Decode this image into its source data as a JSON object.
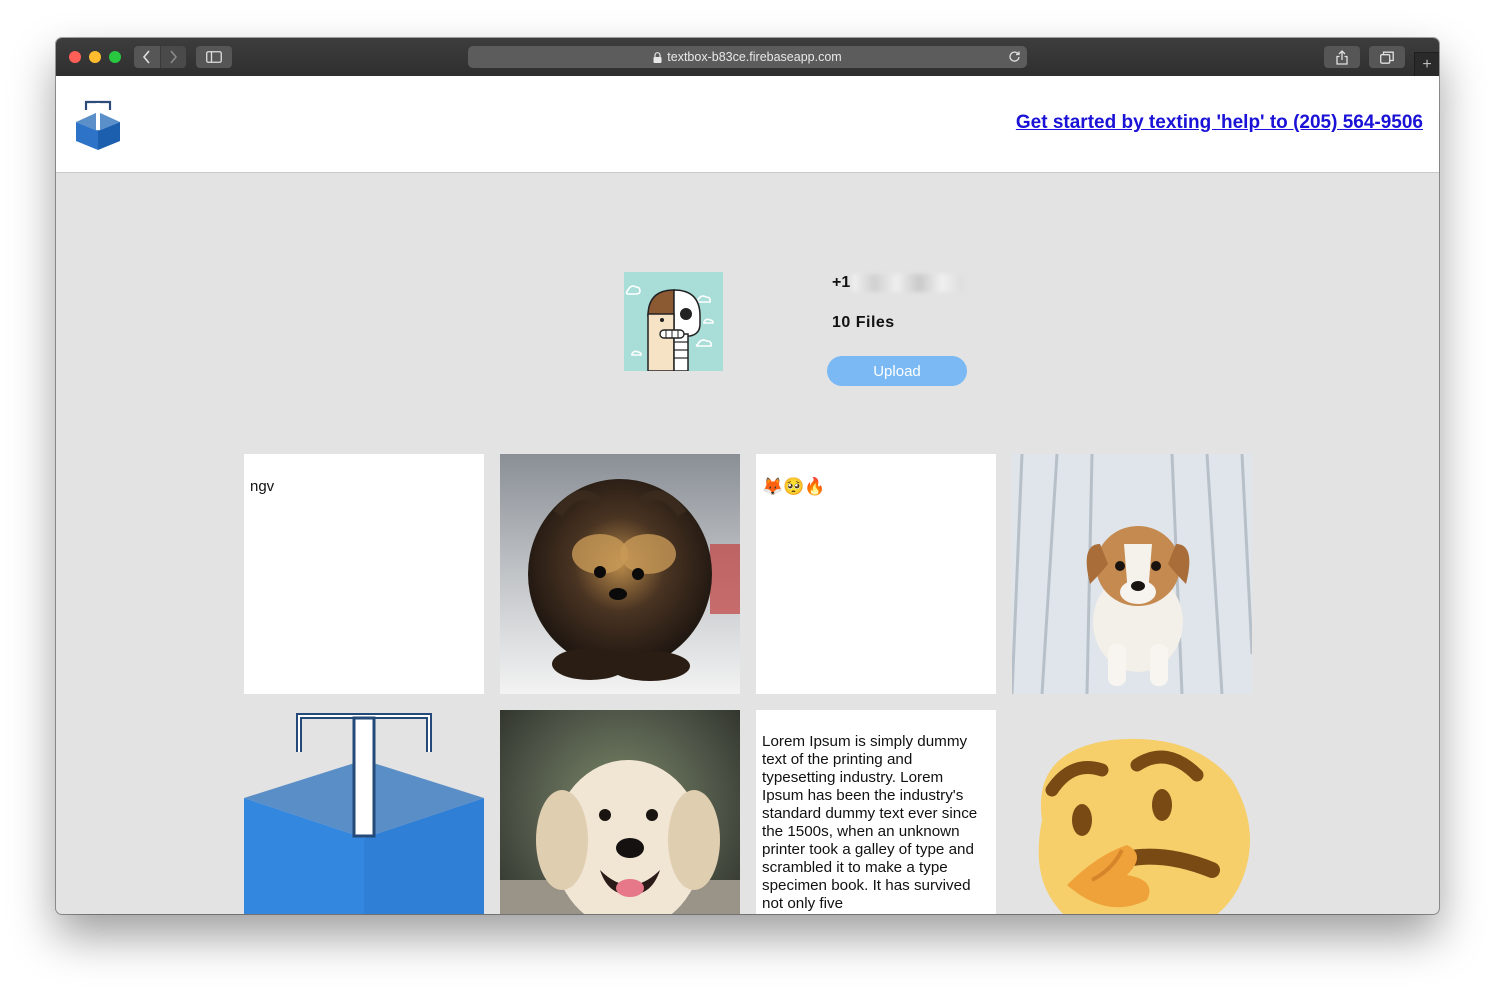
{
  "browser": {
    "url": "textbox-b83ce.firebaseapp.com",
    "new_tab": "+"
  },
  "header": {
    "help_link": "Get started by texting 'help' to (205) 564-9506"
  },
  "profile": {
    "phone_prefix": "+1",
    "files_label": "10 Files",
    "upload_label": "Upload"
  },
  "tiles": [
    {
      "kind": "text",
      "text": "ngv"
    },
    {
      "kind": "image",
      "subject": "fluffy black and tan pomeranian puppy"
    },
    {
      "kind": "text",
      "text": "🦊🥺🔥"
    },
    {
      "kind": "image",
      "subject": "corgi puppy sitting on white deck"
    },
    {
      "kind": "image",
      "subject": "textbox logo"
    },
    {
      "kind": "image",
      "subject": "smiling golden retriever"
    },
    {
      "kind": "text",
      "text": "Lorem Ipsum is simply dummy text of the printing and typesetting industry. Lorem Ipsum has been the industry's standard dummy text ever since the 1500s, when an unknown printer took a galley of type and scrambled it to make a type specimen book. It has survived not only five"
    },
    {
      "kind": "image",
      "subject": "thinking face emoji"
    }
  ],
  "colors": {
    "link": "#1a12d6",
    "upload_button": "#7ab9f3",
    "page_background": "#e3e3e3"
  }
}
